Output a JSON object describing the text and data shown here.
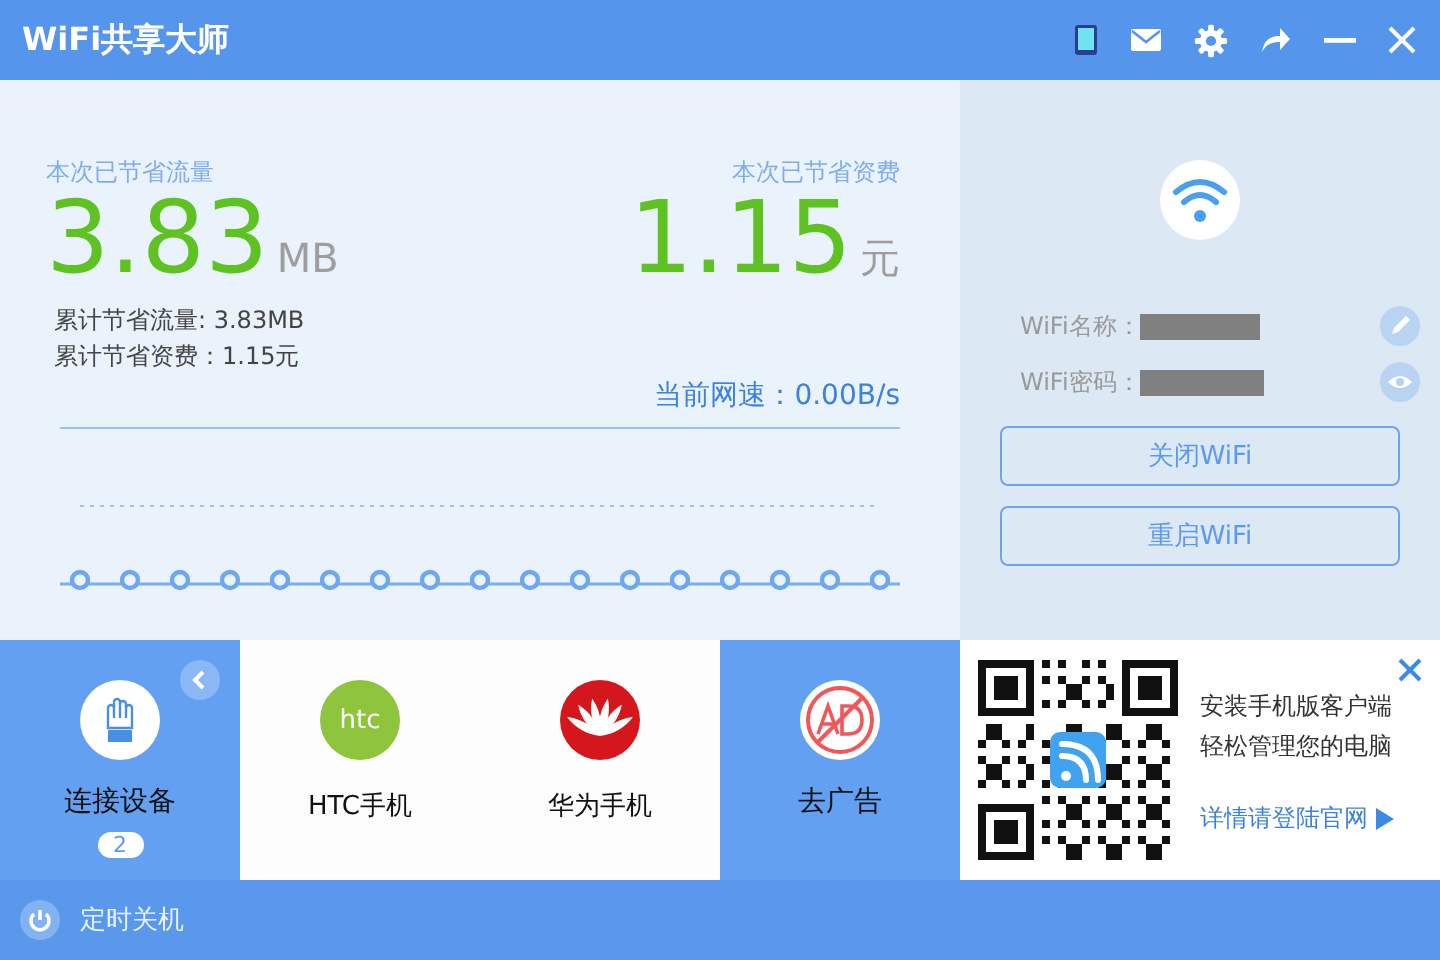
{
  "window": {
    "title": "WiFi共享大师"
  },
  "savings": {
    "traffic_label": "本次已节省流量",
    "traffic_value": "3.83",
    "traffic_unit": "MB",
    "cost_label": "本次已节省资费",
    "cost_value": "1.15",
    "cost_unit": "元"
  },
  "totals": [
    "累计节省流量: 3.83MB",
    "累计节省资费：1.15元"
  ],
  "speed": "当前网速：0.00B/s",
  "wifi": {
    "fields": [
      {
        "label": "WiFi名称：",
        "kind": "edit"
      },
      {
        "label": "WiFi密码：",
        "kind": "reveal"
      }
    ],
    "buttons": [
      "关闭WiFi",
      "重启WiFi"
    ]
  },
  "tiles": [
    {
      "kind": "devices",
      "label": "连接设备",
      "count": "2"
    },
    {
      "kind": "htc",
      "label": "HTC手机",
      "logo_text": "htc"
    },
    {
      "kind": "huawei",
      "label": "华为手机"
    },
    {
      "kind": "noads",
      "label": "去广告"
    }
  ],
  "promo": {
    "lines": [
      "安装手机版客户端",
      "轻松管理您的电脑"
    ],
    "link": "详情请登陆官网"
  },
  "footer": {
    "label": "定时关机"
  }
}
